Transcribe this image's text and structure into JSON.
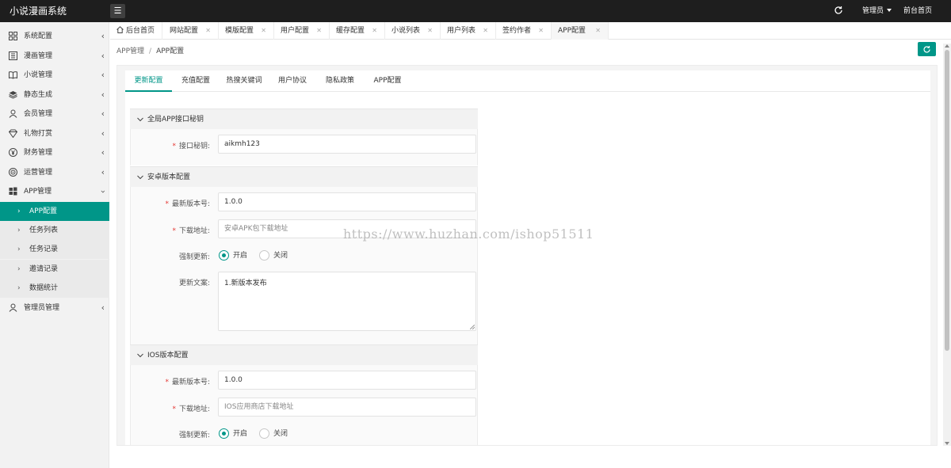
{
  "app": {
    "title": "小说漫画系统"
  },
  "header": {
    "admin_label": "管理员",
    "front_link": "前台首页"
  },
  "sidebar": {
    "items": [
      {
        "label": "系统配置",
        "icon": "settings-icon"
      },
      {
        "label": "漫画管理",
        "icon": "comic-icon"
      },
      {
        "label": "小说管理",
        "icon": "book-icon"
      },
      {
        "label": "静态生成",
        "icon": "layers-icon"
      },
      {
        "label": "会员管理",
        "icon": "members-icon"
      },
      {
        "label": "礼物打赏",
        "icon": "gift-icon"
      },
      {
        "label": "财务管理",
        "icon": "yen-icon"
      },
      {
        "label": "运营管理",
        "icon": "target-icon"
      },
      {
        "label": "APP管理",
        "icon": "windows-icon"
      },
      {
        "label": "管理员管理",
        "icon": "user-icon"
      }
    ],
    "app_sub": [
      {
        "label": "APP配置",
        "active": true
      },
      {
        "label": "任务列表"
      },
      {
        "label": "任务记录"
      },
      {
        "label": "邀请记录"
      },
      {
        "label": "数据统计"
      }
    ]
  },
  "tabs": [
    {
      "label": "后台首页"
    },
    {
      "label": "网站配置"
    },
    {
      "label": "模版配置"
    },
    {
      "label": "用户配置"
    },
    {
      "label": "缓存配置"
    },
    {
      "label": "小说列表"
    },
    {
      "label": "用户列表"
    },
    {
      "label": "签约作者"
    },
    {
      "label": "APP配置",
      "active": true
    }
  ],
  "breadcrumb": {
    "parent": "APP管理",
    "separator": "/",
    "current": "APP配置"
  },
  "subtabs": [
    {
      "label": "更新配置",
      "active": true
    },
    {
      "label": "充值配置"
    },
    {
      "label": "热搜关键词"
    },
    {
      "label": "用户协议"
    },
    {
      "label": "隐私政策"
    },
    {
      "label": "APP配置"
    }
  ],
  "sections": {
    "global": {
      "title": "全局APP接口秘钥",
      "secret_label": "接口秘钥:",
      "secret_value": "aikmh123"
    },
    "android": {
      "title": "安卓版本配置",
      "version_label": "最新版本号:",
      "version_value": "1.0.0",
      "download_label": "下载地址:",
      "download_placeholder": "安卓APK包下载地址",
      "force_label": "强制更新:",
      "force_on": "开启",
      "force_off": "关闭",
      "notes_label": "更新文案:",
      "notes_value": "1.新版本发布"
    },
    "ios": {
      "title": "IOS版本配置",
      "version_label": "最新版本号:",
      "version_value": "1.0.0",
      "download_label": "下载地址:",
      "download_placeholder": "IOS应用商店下载地址",
      "force_label": "强制更新:",
      "force_on": "开启",
      "force_off": "关闭"
    }
  },
  "required_mark": "*",
  "watermark": "https://www.huzhan.com/ishop51511",
  "colors": {
    "accent": "#009688",
    "topbar": "#1e1e1e",
    "required": "#e53935"
  }
}
